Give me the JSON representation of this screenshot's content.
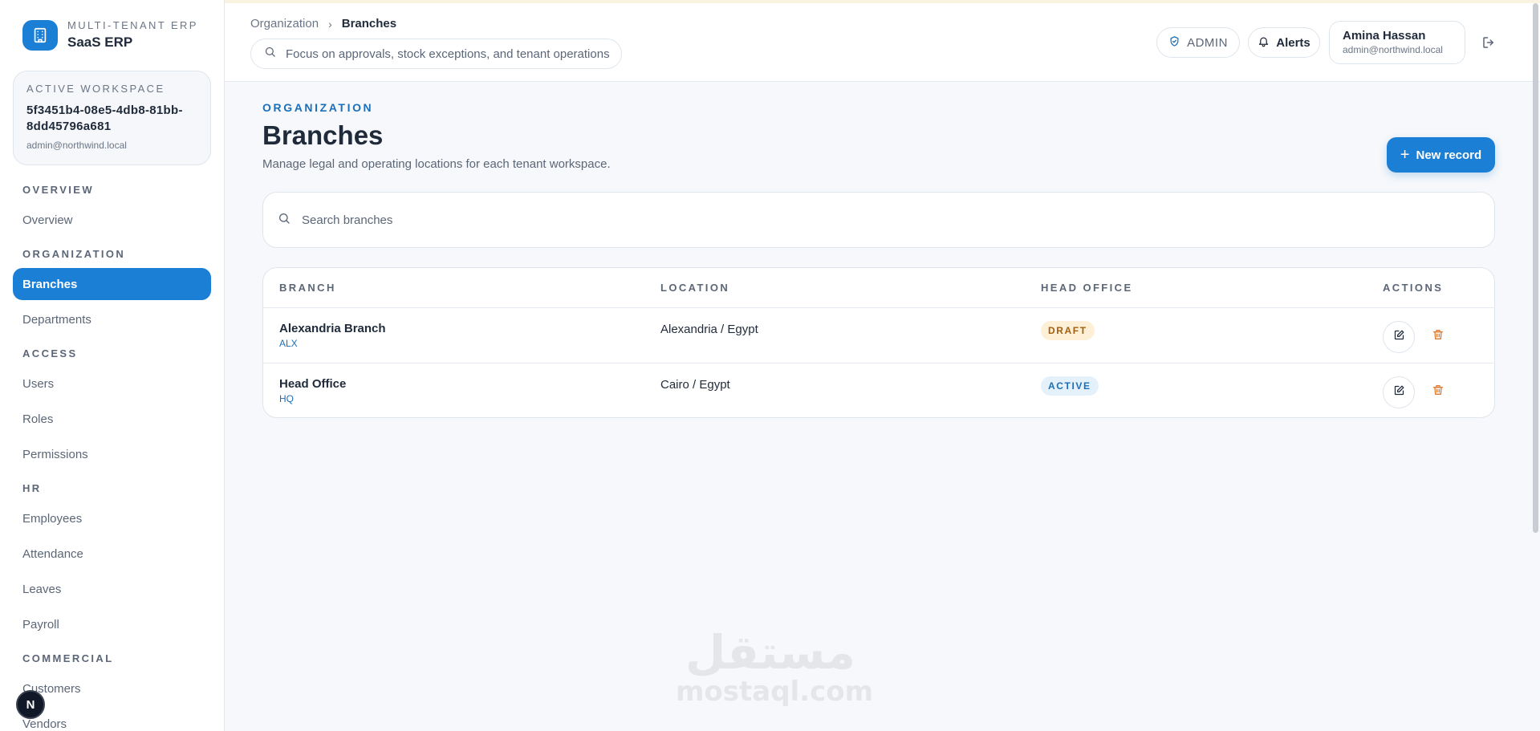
{
  "brand": {
    "kicker": "MULTI-TENANT ERP",
    "name": "SaaS ERP",
    "logo_icon": "building-icon",
    "accent": "#1b7fd6"
  },
  "workspace": {
    "label": "ACTIVE WORKSPACE",
    "id": "5f3451b4-08e5-4db8-81bb-8dd45796a681",
    "email": "admin@northwind.local"
  },
  "sidebar": {
    "sections": [
      {
        "title": "OVERVIEW",
        "items": [
          "Overview"
        ]
      },
      {
        "title": "ORGANIZATION",
        "items": [
          "Branches",
          "Departments"
        ]
      },
      {
        "title": "ACCESS",
        "items": [
          "Users",
          "Roles",
          "Permissions"
        ]
      },
      {
        "title": "HR",
        "items": [
          "Employees",
          "Attendance",
          "Leaves",
          "Payroll"
        ]
      },
      {
        "title": "COMMERCIAL",
        "items": [
          "Customers",
          "Vendors"
        ]
      }
    ],
    "active_item": "Branches"
  },
  "header": {
    "breadcrumb": {
      "root": "Organization",
      "separator": "›",
      "current": "Branches"
    },
    "focus_text": "Focus on approvals, stock exceptions, and tenant operations",
    "role_pill": "ADMIN",
    "alerts_label": "Alerts",
    "user": {
      "name": "Amina Hassan",
      "email": "admin@northwind.local"
    }
  },
  "main": {
    "kicker": "ORGANIZATION",
    "title": "Branches",
    "subtitle": "Manage legal and operating locations for each tenant workspace.",
    "new_button": {
      "icon": "+",
      "label": "New record"
    },
    "search_placeholder": "Search branches",
    "table": {
      "columns": [
        "BRANCH",
        "LOCATION",
        "HEAD OFFICE",
        "ACTIONS"
      ],
      "rows": [
        {
          "name": "Alexandria Branch",
          "code": "ALX",
          "location": "Alexandria / Egypt",
          "status": "DRAFT"
        },
        {
          "name": "Head Office",
          "code": "HQ",
          "location": "Cairo / Egypt",
          "status": "ACTIVE"
        }
      ]
    }
  },
  "floating_badge": "N",
  "watermark": {
    "arabic": "مستقل",
    "latin": "mostaql.com"
  },
  "colors": {
    "accent": "#1b7fd6",
    "draft_bg": "#fdf0d6",
    "draft_text": "#a25f12",
    "active_bg": "#e4f1fb",
    "active_text": "#1b6fba",
    "delete": "#e0782f"
  }
}
